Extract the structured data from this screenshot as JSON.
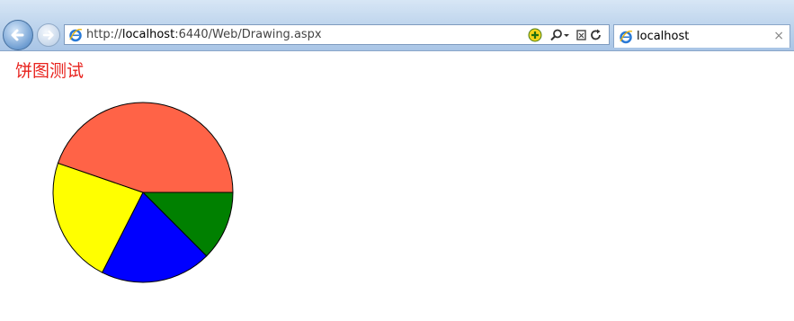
{
  "browser": {
    "address": {
      "scheme": "http://",
      "host": "localhost",
      "rest": ":6440/Web/Drawing.aspx"
    },
    "tab": {
      "title": "localhost",
      "close": "×"
    },
    "icons": {
      "back": "back-arrow-icon",
      "forward": "forward-arrow-icon",
      "ie": "ie-logo-icon",
      "compat": "compatibility-view-icon",
      "search": "search-icon",
      "dropdown": "dropdown-icon",
      "stop": "stop-icon",
      "refresh": "refresh-icon"
    }
  },
  "page": {
    "heading": "饼图测试"
  },
  "chart_data": {
    "type": "pie",
    "title": "",
    "start_angle_deg": 0,
    "direction": "clockwise",
    "slices": [
      {
        "value": 45,
        "color": "#008000"
      },
      {
        "value": 72,
        "color": "#0000ff"
      },
      {
        "value": 82,
        "color": "#ffff00"
      },
      {
        "value": 161,
        "color": "#ff6347"
      }
    ]
  }
}
